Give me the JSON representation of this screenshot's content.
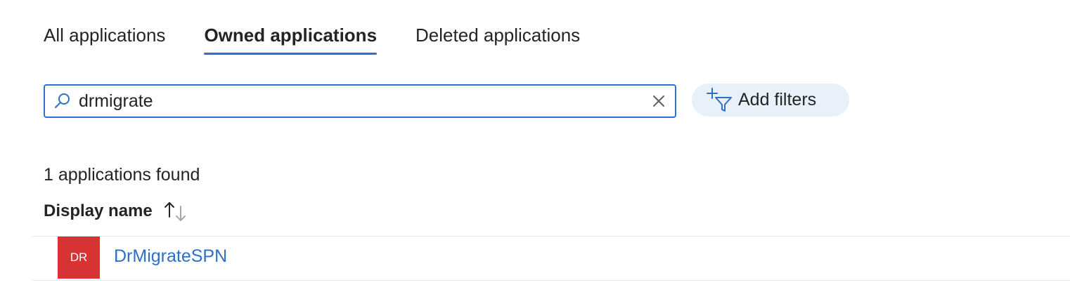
{
  "tabs": [
    {
      "label": "All applications",
      "active": false
    },
    {
      "label": "Owned applications",
      "active": true
    },
    {
      "label": "Deleted applications",
      "active": false
    }
  ],
  "search": {
    "value": "drmigrate",
    "icon": "search-icon",
    "clear_icon": "close-icon"
  },
  "filters": {
    "label": "Add filters",
    "icon": "add-filter-icon"
  },
  "results": {
    "count_text": "1 applications found"
  },
  "table": {
    "columns": [
      {
        "label": "Display name",
        "sort_icon": "sort-ascending-icon"
      }
    ],
    "rows": [
      {
        "initials": "DR",
        "name": "DrMigrateSPN",
        "avatar_color": "#d83333"
      }
    ]
  },
  "colors": {
    "accent": "#2e6fc9",
    "pill_bg": "#e8f0f9",
    "avatar_red": "#d83333",
    "text": "#242424",
    "divider": "#e6e6e6"
  }
}
